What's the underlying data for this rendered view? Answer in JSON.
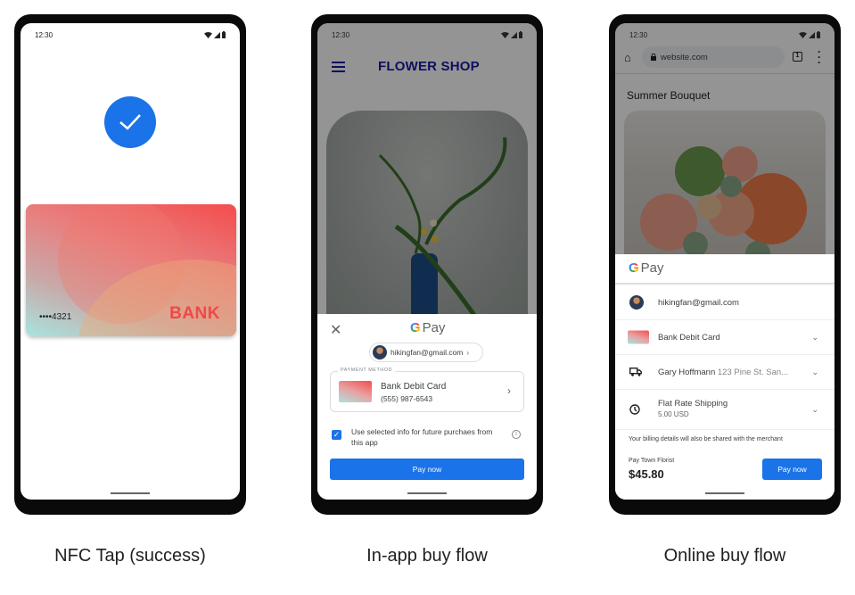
{
  "status_bar": {
    "time": "12:30"
  },
  "phones": [
    {
      "caption": "NFC Tap (success)",
      "card": {
        "number": "••••4321",
        "brand": "BANK"
      }
    },
    {
      "caption": "In-app buy flow",
      "app_title": "FLOWER SHOP",
      "gpay_label": "Pay",
      "account": "hikingfan@gmail.com",
      "payment_method_label": "PAYMENT METHOD",
      "payment_method_title": "Bank Debit Card",
      "payment_method_phone": "(555) 987-6543",
      "checkbox_text": "Use selected info for future purchaes from this app",
      "checkbox_checked": true,
      "pay_button": "Pay now"
    },
    {
      "caption": "Online buy flow",
      "url": "website.com",
      "tab_count": "1",
      "page_title": "Summer Bouquet",
      "gpay_label": "Pay",
      "account": "hikingfan@gmail.com",
      "card": "Bank Debit Card",
      "address_name": "Gary Hoffmann",
      "address_detail": "123 Pine St. San...",
      "shipping_title": "Flat Rate Shipping",
      "shipping_price": "5.00 USD",
      "billing_note": "Your billing details will also be shared with the merchant",
      "pay_to": "Pay Town Florist",
      "total": "$45.80",
      "pay_button": "Pay now"
    }
  ],
  "colors": {
    "accent": "#1a73e8",
    "shop_title": "#1a1aa8",
    "bank_red": "#f04848"
  }
}
